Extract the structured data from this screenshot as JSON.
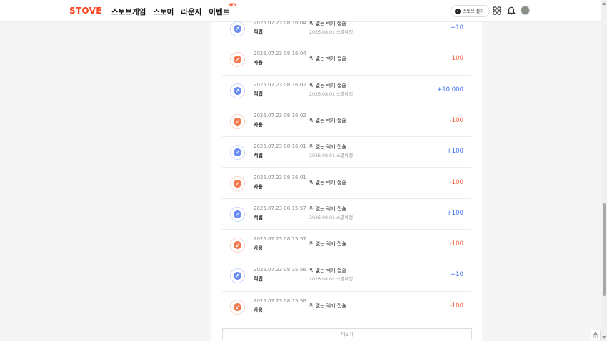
{
  "header": {
    "logo": "STOVE",
    "nav": [
      {
        "label": "스토브게임"
      },
      {
        "label": "스토어"
      },
      {
        "label": "라운지"
      },
      {
        "label": "이벤트",
        "badge": "NEW"
      }
    ],
    "install_label": "스토브 설치"
  },
  "rows": [
    {
      "type": "earn",
      "date": "2025.07.23 08:16:04",
      "kind": "적립",
      "name": "뭐 없는 럭키 캡슐",
      "expiry": "2026.08.01 소멸예정",
      "amount": "+10"
    },
    {
      "type": "use",
      "date": "2025.07.23 08:16:04",
      "kind": "사용",
      "name": "뭐 없는 럭키 캡슐",
      "expiry": "",
      "amount": "-100"
    },
    {
      "type": "earn",
      "date": "2025.07.23 08:16:02",
      "kind": "적립",
      "name": "뭐 없는 럭키 캡슐",
      "expiry": "2026.08.01 소멸예정",
      "amount": "+10,000"
    },
    {
      "type": "use",
      "date": "2025.07.23 08:16:02",
      "kind": "사용",
      "name": "뭐 없는 럭키 캡슐",
      "expiry": "",
      "amount": "-100"
    },
    {
      "type": "earn",
      "date": "2025.07.23 08:16:01",
      "kind": "적립",
      "name": "뭐 없는 럭키 캡슐",
      "expiry": "2026.08.01 소멸예정",
      "amount": "+100"
    },
    {
      "type": "use",
      "date": "2025.07.23 08:16:01",
      "kind": "사용",
      "name": "뭐 없는 럭키 캡슐",
      "expiry": "",
      "amount": "-100"
    },
    {
      "type": "earn",
      "date": "2025.07.23 08:15:57",
      "kind": "적립",
      "name": "뭐 없는 럭키 캡슐",
      "expiry": "2026.08.01 소멸예정",
      "amount": "+100"
    },
    {
      "type": "use",
      "date": "2025.07.23 08:15:57",
      "kind": "사용",
      "name": "뭐 없는 럭키 캡슐",
      "expiry": "",
      "amount": "-100"
    },
    {
      "type": "earn",
      "date": "2025.07.23 08:15:56",
      "kind": "적립",
      "name": "뭐 없는 럭키 캡슐",
      "expiry": "2026.08.01 소멸예정",
      "amount": "+10"
    },
    {
      "type": "use",
      "date": "2025.07.23 08:15:56",
      "kind": "사용",
      "name": "뭐 없는 럭키 캡슐",
      "expiry": "",
      "amount": "-100"
    }
  ],
  "more_label": "더보기",
  "top_label": "TOP",
  "colors": {
    "brand": "#fc4420",
    "earn": "#3a6df0",
    "use": "#f05a35"
  },
  "icons": {
    "earn": "coin-earn-icon",
    "use": "coin-use-icon"
  }
}
